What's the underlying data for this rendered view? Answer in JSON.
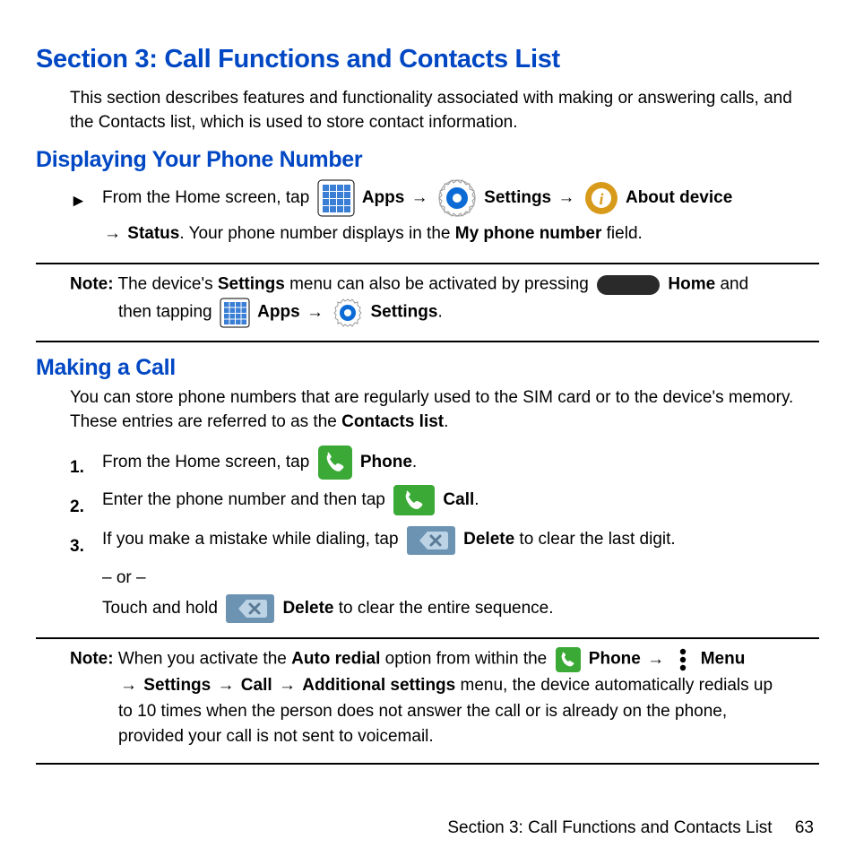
{
  "title": "Section 3: Call Functions and Contacts List",
  "intro": "This section describes features and functionality associated with making or answering calls, and the Contacts list, which is used to store contact information.",
  "sub1": {
    "heading": "Displaying Your Phone Number",
    "step_lead": "From the Home screen, tap ",
    "apps": "Apps",
    "settings": "Settings",
    "about": "About device",
    "status": "Status",
    "tail1": ". Your phone number displays in the ",
    "myphone": "My phone number",
    "tail2": " field."
  },
  "note1": {
    "label": "Note:",
    "l1a": " The device's ",
    "l1b": "Settings",
    "l1c": " menu can also be activated by pressing ",
    "home": "Home",
    "l1d": " and",
    "l2a": "then tapping ",
    "apps": "Apps",
    "settings": "Settings"
  },
  "sub2": {
    "heading": "Making a Call",
    "intro_a": "You can store phone numbers that are regularly used to the SIM card or to the device's memory. These entries are referred to as the ",
    "contacts": "Contacts list",
    "s1a": "From the Home screen, tap ",
    "phone": "Phone",
    "s2a": "Enter the phone number and then tap ",
    "call": "Call",
    "s3a": "If you make a mistake while dialing, tap ",
    "delete": "Delete",
    "s3b": " to clear the last digit.",
    "or": "– or –",
    "s3c": "Touch and hold ",
    "s3d": " to clear the entire sequence."
  },
  "note2": {
    "label": "Note:",
    "a": " When you activate the ",
    "autoredial": "Auto redial",
    "b": " option from within the ",
    "phone": "Phone",
    "menu": "Menu",
    "settings": "Settings",
    "call": "Call",
    "addl": "Additional settings",
    "c": " menu, the device automatically redials up to 10 times when the person does not answer the call or is already on the phone, provided your call is not sent to voicemail."
  },
  "footer": {
    "text": "Section 3:  Call Functions and Contacts List",
    "page": "63"
  }
}
